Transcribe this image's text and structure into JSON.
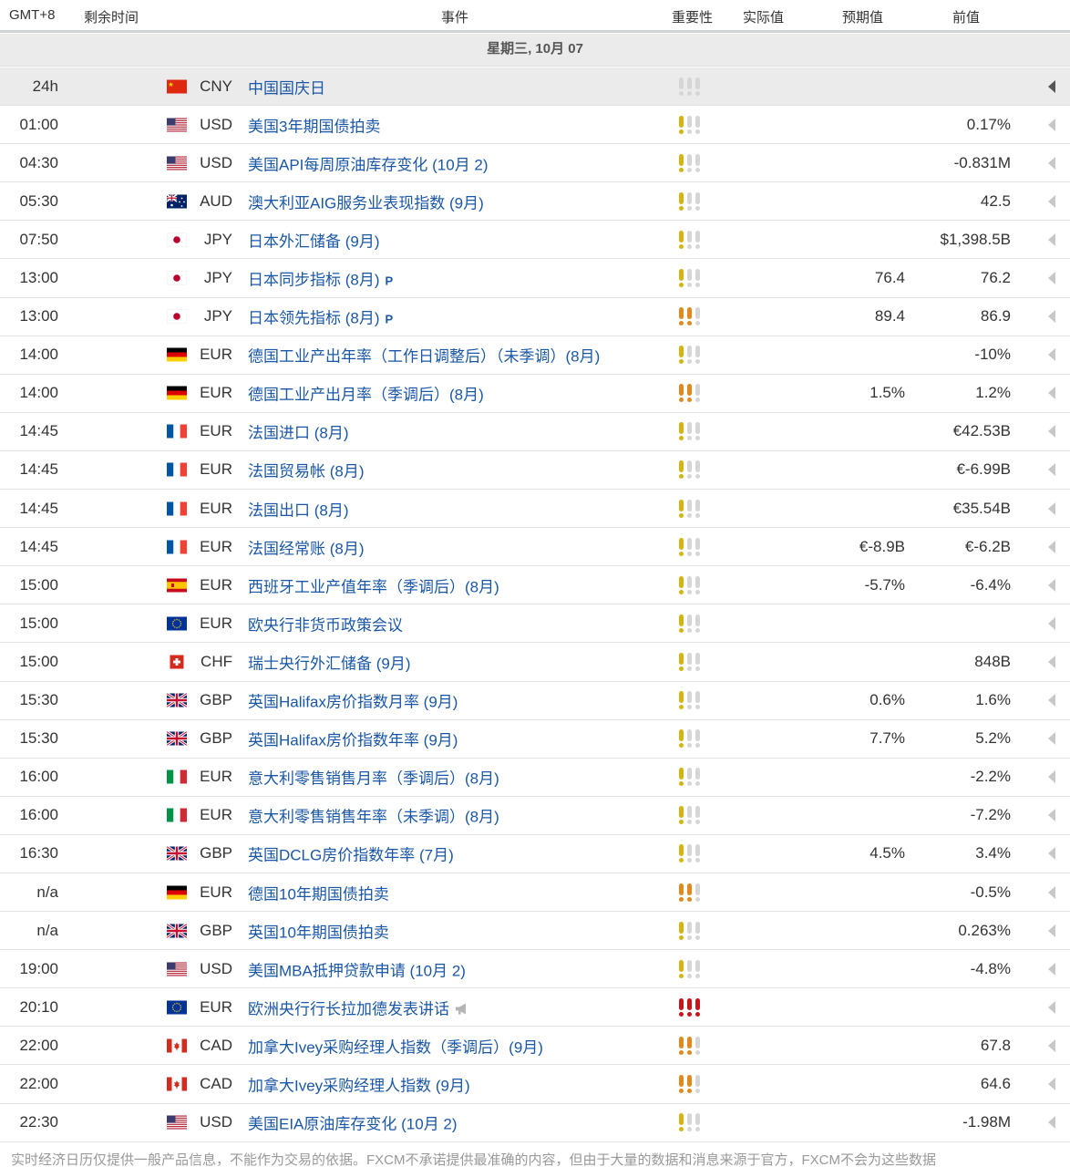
{
  "header": {
    "timezone": "GMT+8",
    "remaining": "剩余时间",
    "event": "事件",
    "importance": "重要性",
    "actual": "实际值",
    "forecast": "预期值",
    "previous": "前值"
  },
  "day_label": "星期三, 10月 07",
  "colors": {
    "low": "#d4b50f",
    "medium": "#e08a1e",
    "high": "#c8151b",
    "empty": "#d6d6d6",
    "link": "#1a57a7"
  },
  "rows": [
    {
      "time": "24h",
      "flag": "cn",
      "currency": "CNY",
      "event": "中国国庆日",
      "importance": 0,
      "forecast": "",
      "previous": "",
      "holiday": true
    },
    {
      "time": "01:00",
      "flag": "us",
      "currency": "USD",
      "event": "美国3年期国债拍卖",
      "importance": 1,
      "forecast": "",
      "previous": "0.17%"
    },
    {
      "time": "04:30",
      "flag": "us",
      "currency": "USD",
      "event": "美国API每周原油库存变化 (10月 2)",
      "importance": 1,
      "forecast": "",
      "previous": "-0.831M"
    },
    {
      "time": "05:30",
      "flag": "au",
      "currency": "AUD",
      "event": "澳大利亚AIG服务业表现指数 (9月)",
      "importance": 1,
      "forecast": "",
      "previous": "42.5"
    },
    {
      "time": "07:50",
      "flag": "jp",
      "currency": "JPY",
      "event": "日本外汇储备 (9月)",
      "importance": 1,
      "forecast": "",
      "previous": "$1,398.5B"
    },
    {
      "time": "13:00",
      "flag": "jp",
      "currency": "JPY",
      "event": "日本同步指标 (8月)",
      "badge": "P",
      "importance": 1,
      "forecast": "76.4",
      "previous": "76.2"
    },
    {
      "time": "13:00",
      "flag": "jp",
      "currency": "JPY",
      "event": "日本领先指标 (8月)",
      "badge": "P",
      "importance": 2,
      "forecast": "89.4",
      "previous": "86.9"
    },
    {
      "time": "14:00",
      "flag": "de",
      "currency": "EUR",
      "event": "德国工业产出年率（工作日调整后）（未季调）(8月)",
      "importance": 1,
      "forecast": "",
      "previous": "-10%"
    },
    {
      "time": "14:00",
      "flag": "de",
      "currency": "EUR",
      "event": "德国工业产出月率（季调后）(8月)",
      "importance": 2,
      "forecast": "1.5%",
      "previous": "1.2%"
    },
    {
      "time": "14:45",
      "flag": "fr",
      "currency": "EUR",
      "event": "法国进口 (8月)",
      "importance": 1,
      "forecast": "",
      "previous": "€42.53B"
    },
    {
      "time": "14:45",
      "flag": "fr",
      "currency": "EUR",
      "event": "法国贸易帐 (8月)",
      "importance": 1,
      "forecast": "",
      "previous": "€-6.99B"
    },
    {
      "time": "14:45",
      "flag": "fr",
      "currency": "EUR",
      "event": "法国出口 (8月)",
      "importance": 1,
      "forecast": "",
      "previous": "€35.54B"
    },
    {
      "time": "14:45",
      "flag": "fr",
      "currency": "EUR",
      "event": "法国经常账 (8月)",
      "importance": 1,
      "forecast": "€-8.9B",
      "previous": "€-6.2B"
    },
    {
      "time": "15:00",
      "flag": "es",
      "currency": "EUR",
      "event": "西班牙工业产值年率（季调后）(8月)",
      "importance": 1,
      "forecast": "-5.7%",
      "previous": "-6.4%"
    },
    {
      "time": "15:00",
      "flag": "eu",
      "currency": "EUR",
      "event": "欧央行非货币政策会议",
      "importance": 1,
      "forecast": "",
      "previous": ""
    },
    {
      "time": "15:00",
      "flag": "ch",
      "currency": "CHF",
      "event": "瑞士央行外汇储备 (9月)",
      "importance": 1,
      "forecast": "",
      "previous": "848B"
    },
    {
      "time": "15:30",
      "flag": "gb",
      "currency": "GBP",
      "event": "英国Halifax房价指数月率 (9月)",
      "importance": 1,
      "forecast": "0.6%",
      "previous": "1.6%"
    },
    {
      "time": "15:30",
      "flag": "gb",
      "currency": "GBP",
      "event": "英国Halifax房价指数年率 (9月)",
      "importance": 1,
      "forecast": "7.7%",
      "previous": "5.2%"
    },
    {
      "time": "16:00",
      "flag": "it",
      "currency": "EUR",
      "event": "意大利零售销售月率（季调后）(8月)",
      "importance": 1,
      "forecast": "",
      "previous": "-2.2%"
    },
    {
      "time": "16:00",
      "flag": "it",
      "currency": "EUR",
      "event": "意大利零售销售年率（未季调）(8月)",
      "importance": 1,
      "forecast": "",
      "previous": "-7.2%"
    },
    {
      "time": "16:30",
      "flag": "gb",
      "currency": "GBP",
      "event": "英国DCLG房价指数年率 (7月)",
      "importance": 1,
      "forecast": "4.5%",
      "previous": "3.4%"
    },
    {
      "time": "n/a",
      "flag": "de",
      "currency": "EUR",
      "event": "德国10年期国债拍卖",
      "importance": 2,
      "forecast": "",
      "previous": "-0.5%"
    },
    {
      "time": "n/a",
      "flag": "gb",
      "currency": "GBP",
      "event": "英国10年期国债拍卖",
      "importance": 1,
      "forecast": "",
      "previous": "0.263%"
    },
    {
      "time": "19:00",
      "flag": "us",
      "currency": "USD",
      "event": "美国MBA抵押贷款申请 (10月 2)",
      "importance": 1,
      "forecast": "",
      "previous": "-4.8%"
    },
    {
      "time": "20:10",
      "flag": "eu",
      "currency": "EUR",
      "event": "欧洲央行行长拉加德发表讲话",
      "speech": true,
      "importance": 3,
      "forecast": "",
      "previous": ""
    },
    {
      "time": "22:00",
      "flag": "ca",
      "currency": "CAD",
      "event": "加拿大Ivey采购经理人指数（季调后）(9月)",
      "importance": 2,
      "forecast": "",
      "previous": "67.8"
    },
    {
      "time": "22:00",
      "flag": "ca",
      "currency": "CAD",
      "event": "加拿大Ivey采购经理人指数 (9月)",
      "importance": 2,
      "forecast": "",
      "previous": "64.6"
    },
    {
      "time": "22:30",
      "flag": "us",
      "currency": "USD",
      "event": "美国EIA原油库存变化 (10月 2)",
      "importance": 1,
      "forecast": "",
      "previous": "-1.98M"
    }
  ],
  "footer_text": "实时经济日历仅提供一般产品信息，不能作为交易的依据。FXCM不承诺提供最准确的内容，但由于大量的数据和消息来源于官方，FXCM不会为这些数据"
}
